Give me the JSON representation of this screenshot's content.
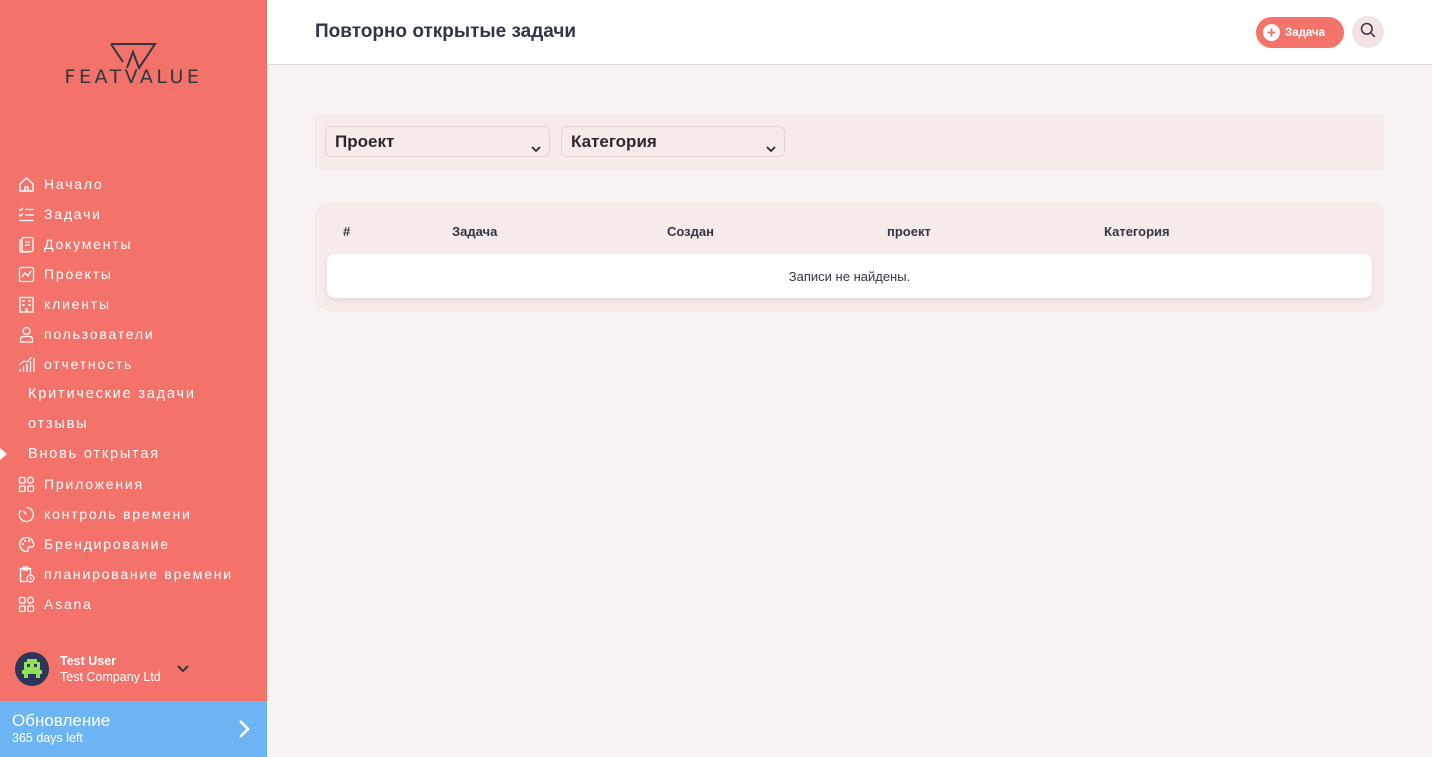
{
  "brand": {
    "name": "FEATVALUE"
  },
  "sidebar": {
    "items": [
      {
        "label": "Начало",
        "icon": "home-icon"
      },
      {
        "label": "Задачи",
        "icon": "task-list-icon"
      },
      {
        "label": "Документы",
        "icon": "documents-icon"
      },
      {
        "label": "Проекты",
        "icon": "projects-icon"
      },
      {
        "label": "клиенты",
        "icon": "building-icon"
      },
      {
        "label": "пользователи",
        "icon": "user-icon"
      },
      {
        "label": "отчетность",
        "icon": "chart-icon"
      },
      {
        "label": "Критические задачи"
      },
      {
        "label": "отзывы"
      },
      {
        "label": "Вновь открытая",
        "active": true
      },
      {
        "label": "Приложения",
        "icon": "apps-icon"
      },
      {
        "label": "контроль времени",
        "icon": "timer-icon"
      },
      {
        "label": "Брендирование",
        "icon": "palette-icon"
      },
      {
        "label": "планирование времени",
        "icon": "clipboard-clock-icon"
      },
      {
        "label": "Asana",
        "icon": "apps-icon"
      }
    ],
    "user": {
      "name": "Test User",
      "company": "Test Company Ltd"
    },
    "upgrade": {
      "title": "Обновление",
      "subtitle": "365 days left"
    }
  },
  "header": {
    "title": "Повторно открытые задачи",
    "task_button": "Задача"
  },
  "filters": {
    "project": "Проект",
    "category": "Категория"
  },
  "table": {
    "columns": [
      "#",
      "Задача",
      "Создан",
      "проект",
      "Категория"
    ],
    "empty_message": "Записи не найдены."
  },
  "colors": {
    "sidebar": "#f3726a",
    "upgrade": "#6db4f2",
    "background": "#f7f3f2",
    "panel": "#f7ebe9",
    "title_text": "#2f3648"
  }
}
